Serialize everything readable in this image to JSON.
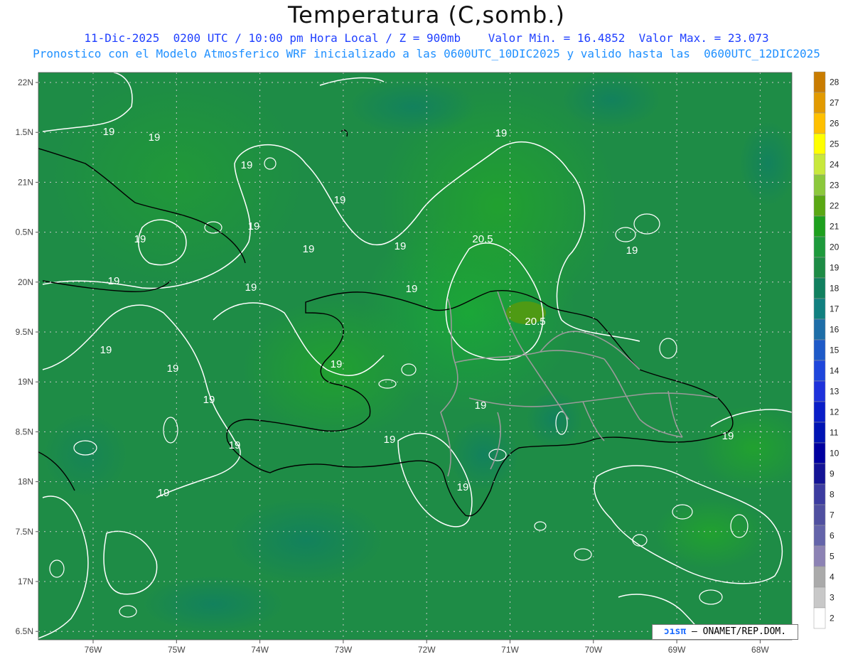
{
  "title": "Temperatura (C,somb.)",
  "subtitle1": "11-Dic-2025  0200 UTC / 10:00 pm Hora Local / Z = 900mb    Valor Min. = 16.4852  Valor Max. = 23.073",
  "subtitle2": "Pronostico con el Modelo Atmosferico WRF inicializado a las 0600UTC_10DIC2025 y valido hasta las  0600UTC_12DIC2025",
  "credit": {
    "logo": "ɔısπ",
    "text": " – ONAMET/REP.DOM."
  },
  "map": {
    "lat_labels": [
      "22N",
      "1.5N",
      "21N",
      "0.5N",
      "20N",
      "9.5N",
      "19N",
      "8.5N",
      "18N",
      "7.5N",
      "17N",
      "6.5N"
    ],
    "lon_labels": [
      "76W",
      "75W",
      "74W",
      "73W",
      "72W",
      "71W",
      "70W",
      "69W",
      "68W"
    ],
    "contour_labels": [
      "19",
      "19",
      "19",
      "19",
      "19",
      "19",
      "19",
      "19",
      "19",
      "19",
      "19",
      "19",
      "19",
      "19",
      "19",
      "19",
      "19",
      "19",
      "19",
      "19",
      "19",
      "19",
      "19",
      "20.5",
      "20.5"
    ],
    "colors": {
      "field_base": "#1e8c46",
      "warm": "#1aa838",
      "cool": "#11805f",
      "contour": "#ffffff",
      "border": "#9a9a9a"
    }
  },
  "colorbar": {
    "labels": [
      "28",
      "27",
      "26",
      "25",
      "24",
      "23",
      "22",
      "21",
      "20",
      "19",
      "18",
      "17",
      "16",
      "15",
      "14",
      "13",
      "12",
      "11",
      "10",
      "9",
      "8",
      "7",
      "6",
      "5",
      "4",
      "3",
      "2"
    ],
    "colors": [
      "#c97c00",
      "#e29a00",
      "#ffc000",
      "#ffff00",
      "#c8e83c",
      "#8cc83c",
      "#5aa814",
      "#1ea01e",
      "#1e9a3c",
      "#1e8c46",
      "#11805f",
      "#118080",
      "#1e6ea8",
      "#1e5ac8",
      "#1e46dc",
      "#1e32dc",
      "#0a1ec8",
      "#0014b4",
      "#0000a0",
      "#141496",
      "#3c3ca0",
      "#5050a0",
      "#6464aa",
      "#8c82b4",
      "#aaaaaa",
      "#c8c8c8",
      "#ffffff"
    ]
  }
}
